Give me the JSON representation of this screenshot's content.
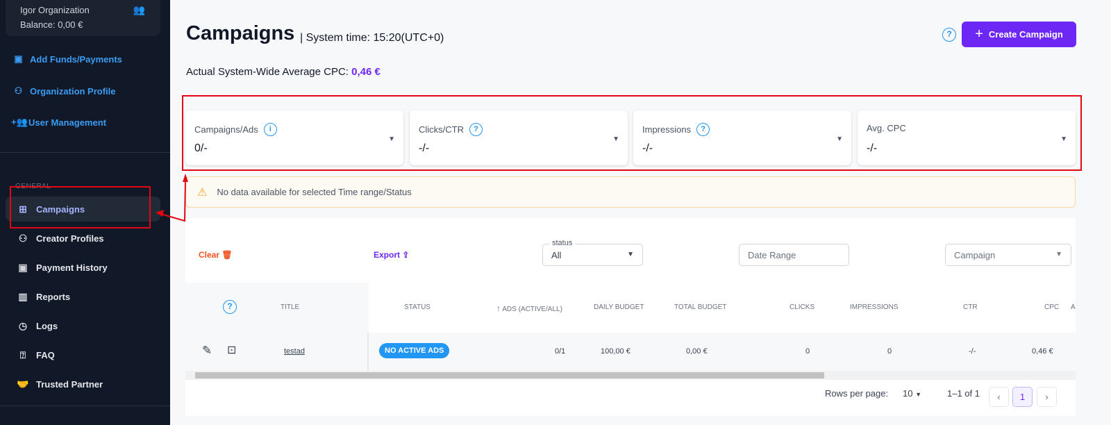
{
  "sidebar": {
    "org_name": "Igor Organization",
    "balance": "Balance: 0,00 €",
    "links": [
      {
        "label": "Add Funds/Payments",
        "icon": "wallet-icon"
      },
      {
        "label": "Organization Profile",
        "icon": "person-icon"
      },
      {
        "label": "User Management",
        "icon": "add-user-icon"
      }
    ],
    "section": "GENERAL",
    "items": [
      {
        "label": "Campaigns",
        "icon": "grid-icon",
        "active": true
      },
      {
        "label": "Creator Profiles",
        "icon": "users-icon"
      },
      {
        "label": "Payment History",
        "icon": "wallet-icon"
      },
      {
        "label": "Reports",
        "icon": "report-icon"
      },
      {
        "label": "Logs",
        "icon": "clock-icon"
      },
      {
        "label": "FAQ",
        "icon": "question-box-icon"
      },
      {
        "label": "Trusted Partner",
        "icon": "handshake-icon"
      }
    ]
  },
  "header": {
    "title": "Campaigns",
    "system_time": "| System time: 15:20(UTC+0)",
    "create_label": "Create Campaign",
    "avg_label": "Actual System-Wide Average CPC:",
    "avg_value": "0,46 €"
  },
  "stats": [
    {
      "label": "Campaigns/Ads",
      "value": "0/-",
      "icon": "info-icon"
    },
    {
      "label": "Clicks/CTR",
      "value": "-/-",
      "icon": "question-icon"
    },
    {
      "label": "Impressions",
      "value": "-/-",
      "icon": "question-icon"
    },
    {
      "label": "Avg. CPC",
      "value": "-/-"
    }
  ],
  "alert": "No data available for selected Time range/Status",
  "filters": {
    "clear": "Clear",
    "export": "Export",
    "status_label": "status",
    "status_value": "All",
    "date_placeholder": "Date Range",
    "campaign_placeholder": "Campaign"
  },
  "table": {
    "headers": [
      "TITLE",
      "STATUS",
      "ADS (ACTIVE/ALL)",
      "DAILY BUDGET",
      "TOTAL BUDGET",
      "CLICKS",
      "IMPRESSIONS",
      "CTR",
      "CPC",
      "A"
    ],
    "rows": [
      {
        "title": "testad",
        "status": "NO ACTIVE ADS",
        "ads": "0/1",
        "daily_budget": "100,00 €",
        "total_budget": "0,00 €",
        "clicks": "0",
        "impressions": "0",
        "ctr": "-/-",
        "cpc": "0,46 €"
      }
    ]
  },
  "pagination": {
    "rows_label": "Rows per page:",
    "rows_value": "10",
    "range": "1–1 of 1",
    "page": "1"
  },
  "colors": {
    "accent": "#6d28f5",
    "info": "#2196f3",
    "annotation": "#e30613"
  }
}
